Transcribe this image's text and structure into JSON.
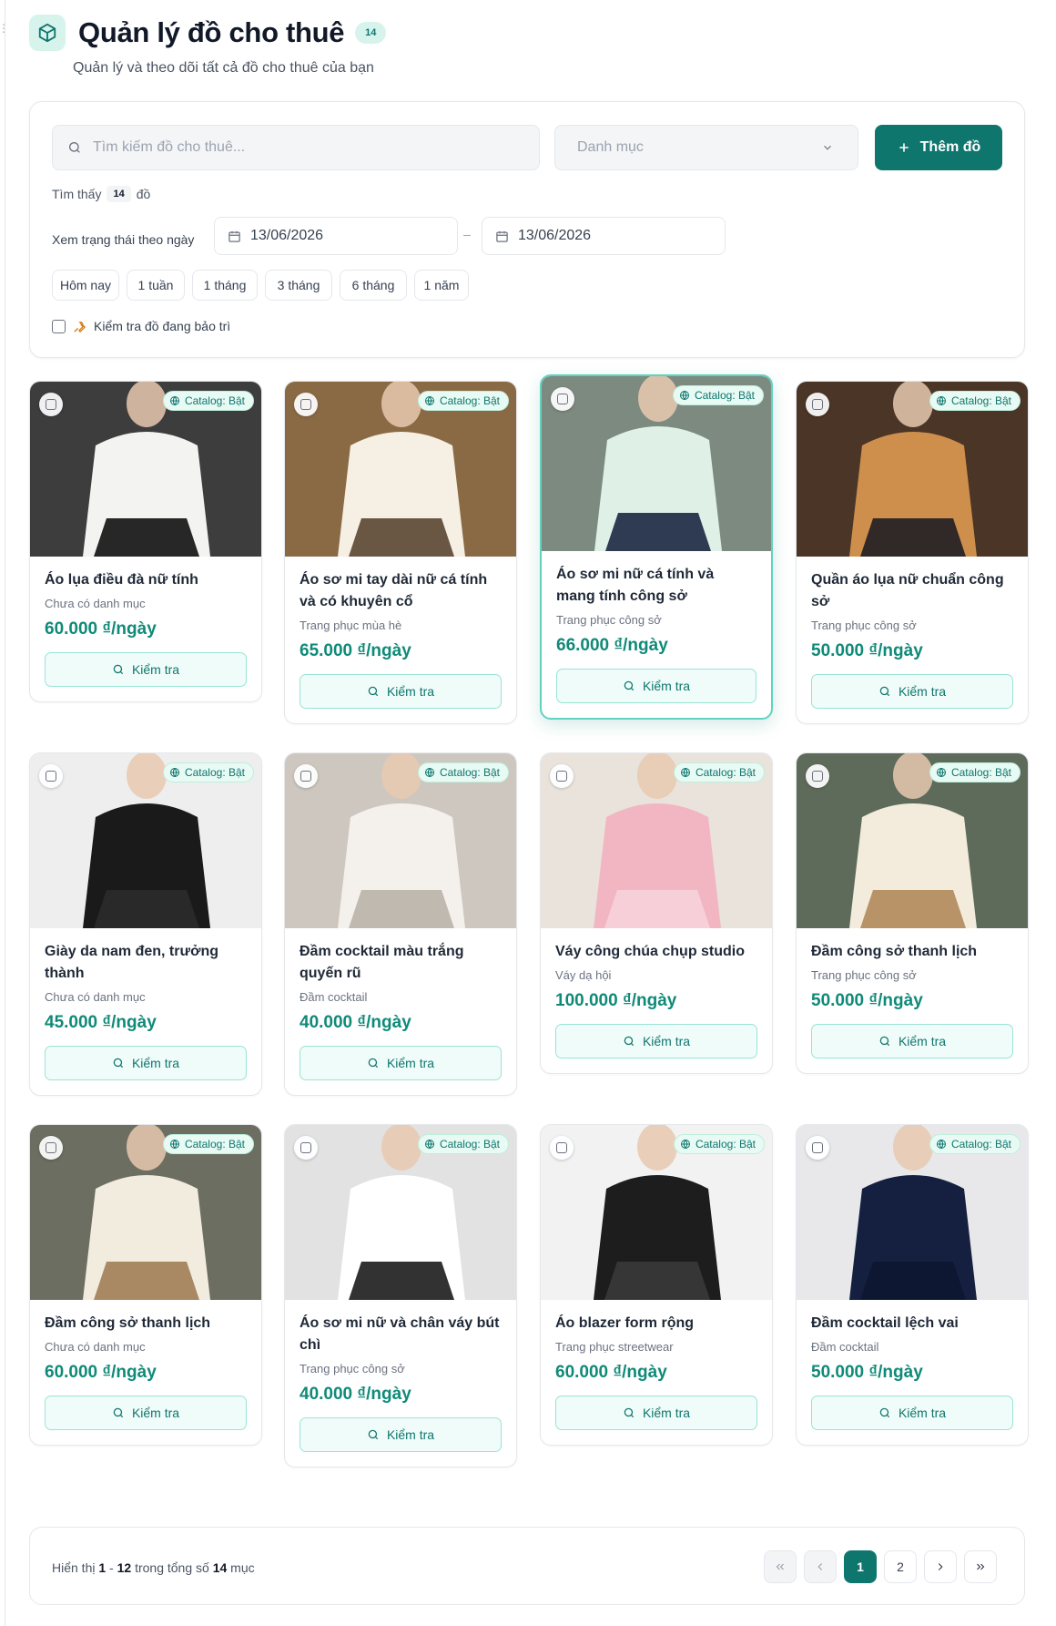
{
  "header": {
    "title": "Quản lý đồ cho thuê",
    "count_badge": "14",
    "subtitle": "Quản lý và theo dõi tất cả đồ cho thuê của bạn"
  },
  "filters": {
    "search_placeholder": "Tìm kiếm đồ cho thuê...",
    "category_placeholder": "Danh mục",
    "add_button": "Thêm đồ",
    "found_prefix": "Tìm thấy",
    "found_count": "14",
    "found_suffix": "đồ",
    "date_label": "Xem trạng thái theo ngày",
    "date_from": "13/06/2026",
    "date_separator": "–",
    "date_to": "13/06/2026",
    "quick_ranges": [
      "Hôm nay",
      "1 tuần",
      "1 tháng",
      "3 tháng",
      "6 tháng",
      "1 năm"
    ],
    "maintenance_label": "Kiểm tra đồ đang bảo trì",
    "maintenance_checked": false
  },
  "colors": {
    "primary": "#0f766e",
    "price": "#0f8a78",
    "badge_bg": "#e8faf4"
  },
  "items": [
    {
      "name": "Áo lụa điều đà nữ tính",
      "category": "Chưa có danh mục",
      "price": "60.000 ₫/ngày",
      "badge": "Catalog: Bật",
      "action": "Kiểm tra"
    },
    {
      "name": "Áo sơ mi tay dài nữ cá tính và có khuyên cổ",
      "category": "Trang phục mùa hè",
      "price": "65.000 ₫/ngày",
      "badge": "Catalog: Bật",
      "action": "Kiểm tra"
    },
    {
      "name": "Áo sơ mi nữ cá tính và mang tính công sở",
      "category": "Trang phục công sở",
      "price": "66.000 ₫/ngày",
      "badge": "Catalog: Bật",
      "action": "Kiểm tra"
    },
    {
      "name": "Quần áo lụa nữ chuẩn công sở",
      "category": "Trang phục công sở",
      "price": "50.000 ₫/ngày",
      "badge": "Catalog: Bật",
      "action": "Kiểm tra"
    },
    {
      "name": "Giày da nam đen, trưởng thành",
      "category": "Chưa có danh mục",
      "price": "45.000 ₫/ngày",
      "badge": "Catalog: Bật",
      "action": "Kiểm tra"
    },
    {
      "name": "Đầm cocktail màu trắng quyến rũ",
      "category": "Đầm cocktail",
      "price": "40.000 ₫/ngày",
      "badge": "Catalog: Bật",
      "action": "Kiểm tra"
    },
    {
      "name": "Váy công chúa chụp studio",
      "category": "Váy dạ hội",
      "price": "100.000 ₫/ngày",
      "badge": "Catalog: Bật",
      "action": "Kiểm tra"
    },
    {
      "name": "Đầm công sở thanh lịch",
      "category": "Trang phục công sở",
      "price": "50.000 ₫/ngày",
      "badge": "Catalog: Bật",
      "action": "Kiểm tra"
    },
    {
      "name": "Đầm công sở thanh lịch",
      "category": "Chưa có danh mục",
      "price": "60.000 ₫/ngày",
      "badge": "Catalog: Bật",
      "action": "Kiểm tra"
    },
    {
      "name": "Áo sơ mi nữ và chân váy bút chì",
      "category": "Trang phục công sở",
      "price": "40.000 ₫/ngày",
      "badge": "Catalog: Bật",
      "action": "Kiểm tra"
    },
    {
      "name": "Áo blazer form rộng",
      "category": "Trang phục streetwear",
      "price": "60.000 ₫/ngày",
      "badge": "Catalog: Bật",
      "action": "Kiểm tra"
    },
    {
      "name": "Đầm cocktail lệch vai",
      "category": "Đầm cocktail",
      "price": "50.000 ₫/ngày",
      "badge": "Catalog: Bật",
      "action": "Kiểm tra"
    }
  ],
  "pagination": {
    "prefix": "Hiển thị",
    "from": "1",
    "dash": "-",
    "to": "12",
    "middle": "trong tổng số",
    "total": "14",
    "suffix": "mục",
    "pages": [
      "1",
      "2"
    ],
    "current_page": "1"
  }
}
